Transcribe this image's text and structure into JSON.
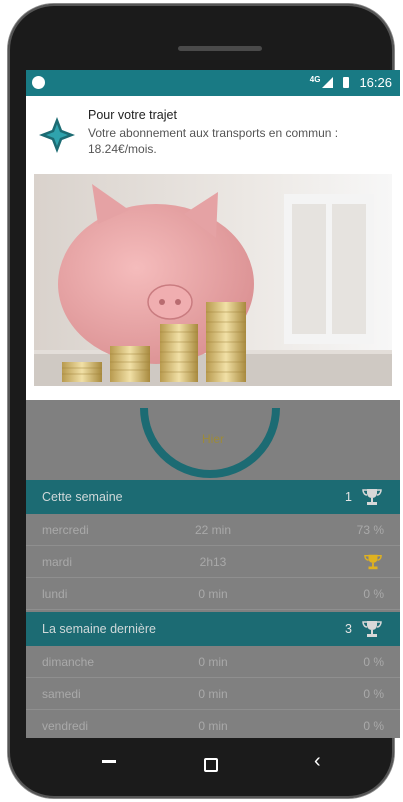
{
  "status_bar": {
    "network": "4G",
    "time": "16:26"
  },
  "notification": {
    "title": "Pour votre trajet",
    "text": "Votre abonnement aux transports en commun : 18.24€/mois."
  },
  "chart": {
    "label": "Hier"
  },
  "this_week": {
    "label": "Cette semaine",
    "rank": "1",
    "rows": [
      {
        "day": "mercredi",
        "duration": "22 min",
        "percent": "73 %"
      },
      {
        "day": "mardi",
        "duration": "2h13",
        "percent": ""
      },
      {
        "day": "lundi",
        "duration": "0 min",
        "percent": "0 %"
      }
    ]
  },
  "last_week": {
    "label": "La semaine dernière",
    "rank": "3",
    "rows": [
      {
        "day": "dimanche",
        "duration": "0 min",
        "percent": "0 %"
      },
      {
        "day": "samedi",
        "duration": "0 min",
        "percent": "0 %"
      },
      {
        "day": "vendredi",
        "duration": "0 min",
        "percent": "0 %"
      }
    ]
  },
  "colors": {
    "teal": "#1c6b73",
    "statusbar": "#197a84",
    "gold": "#e0b21f"
  },
  "icons": [
    "notification-dot-icon",
    "signal-icon",
    "battery-icon",
    "app-logo-icon",
    "trophy-icon",
    "back-icon",
    "home-icon",
    "recent-apps-icon"
  ]
}
